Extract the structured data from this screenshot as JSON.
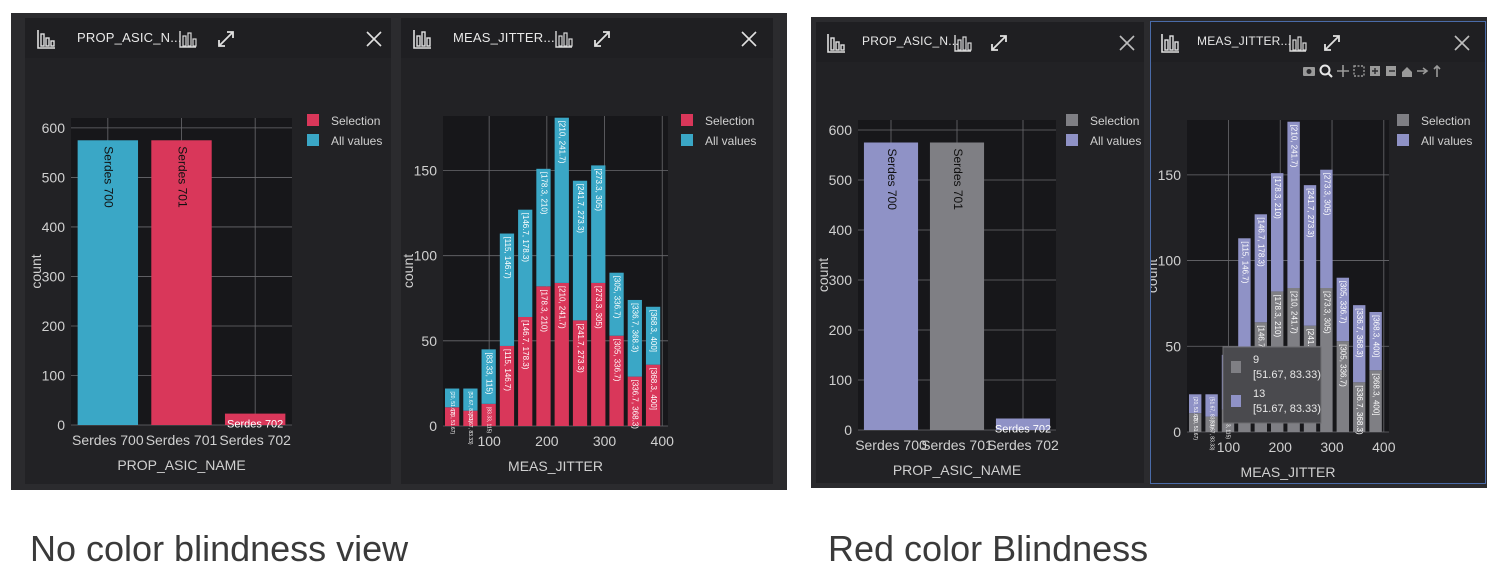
{
  "captions": {
    "left": "No color blindness view",
    "right": "Red color Blindness"
  },
  "views": [
    {
      "panels": [
        {
          "title": "PROP_ASIC_N...",
          "chart_data": {
            "type": "bar",
            "stacked": true,
            "xlabel": "PROP_ASIC_NAME",
            "ylabel": "count",
            "ylim": [
              0,
              620
            ],
            "yticks": [
              0,
              100,
              200,
              300,
              400,
              500,
              600
            ],
            "categories": [
              "Serdes 700",
              "Serdes 701",
              "Serdes 702"
            ],
            "series": [
              {
                "name": "Selection",
                "color": "#d9375a",
                "values": [
                  0,
                  575,
                  23
                ]
              },
              {
                "name": "All values",
                "color": "#3aa7c6",
                "values": [
                  575,
                  0,
                  0
                ]
              }
            ],
            "bar_labels": [
              "Serdes 700",
              "Serdes 701",
              "Serdes 702"
            ],
            "legend": "top-right"
          }
        },
        {
          "title": "MEAS_JITTER...",
          "chart_data": {
            "type": "bar",
            "stacked": true,
            "xlabel": "MEAS_JITTER",
            "ylabel": "count",
            "xlim": [
              20,
              410
            ],
            "xticks": [
              100,
              200,
              300,
              400
            ],
            "ylim": [
              0,
              182
            ],
            "yticks": [
              0,
              50,
              100,
              150
            ],
            "bins": [
              {
                "x0": 20,
                "x1": 51.67,
                "label": "[20, 51.67)"
              },
              {
                "x0": 51.67,
                "x1": 83.33,
                "label": "[51.67, 83.33)"
              },
              {
                "x0": 83.33,
                "x1": 115,
                "label": "[83.33, 115)"
              },
              {
                "x0": 115,
                "x1": 146.7,
                "label": "[115, 146.7)"
              },
              {
                "x0": 146.7,
                "x1": 178.3,
                "label": "[146.7, 178.3)"
              },
              {
                "x0": 178.3,
                "x1": 210,
                "label": "[178.3, 210)"
              },
              {
                "x0": 210,
                "x1": 241.7,
                "label": "[210, 241.7)"
              },
              {
                "x0": 241.7,
                "x1": 273.3,
                "label": "[241.7, 273.3)"
              },
              {
                "x0": 273.3,
                "x1": 305,
                "label": "[273.3, 305)"
              },
              {
                "x0": 305,
                "x1": 336.7,
                "label": "[305, 336.7)"
              },
              {
                "x0": 336.7,
                "x1": 368.3,
                "label": "[336.7, 368.3)"
              },
              {
                "x0": 368.3,
                "x1": 400,
                "label": "[368.3, 400]"
              }
            ],
            "series": [
              {
                "name": "Selection",
                "color": "#d9375a",
                "values": [
                  11,
                  9,
                  13,
                  47,
                  64,
                  82,
                  84,
                  62,
                  84,
                  53,
                  29,
                  36
                ]
              },
              {
                "name": "All values",
                "color": "#3aa7c6",
                "values": [
                  11,
                  13,
                  32,
                  66,
                  63,
                  69,
                  97,
                  82,
                  69,
                  37,
                  45,
                  34
                ]
              }
            ],
            "legend": "top-right"
          }
        }
      ]
    },
    {
      "panels": [
        {
          "title": "PROP_ASIC_N...",
          "chart_data": {
            "type": "bar",
            "stacked": true,
            "xlabel": "PROP_ASIC_NAME",
            "ylabel": "count",
            "ylim": [
              0,
              620
            ],
            "yticks": [
              0,
              100,
              200,
              300,
              400,
              500,
              600
            ],
            "categories": [
              "Serdes 700",
              "Serdes 701",
              "Serdes 702"
            ],
            "series": [
              {
                "name": "Selection",
                "color": "#7f7f84",
                "values": [
                  0,
                  575,
                  0
                ]
              },
              {
                "name": "All values",
                "color": "#8f92c6",
                "values": [
                  575,
                  0,
                  23
                ]
              }
            ],
            "bar_labels": [
              "Serdes 700",
              "Serdes 701",
              "Serdes 702"
            ],
            "legend": "top-right"
          }
        },
        {
          "title": "MEAS_JITTER...",
          "toolbar_icons": [
            "camera-icon",
            "zoom-icon",
            "pan-icon",
            "box-select-icon",
            "zoom-in-icon",
            "zoom-out-icon",
            "autoscale-icon",
            "reset-axes-icon",
            "spike-lines-icon"
          ],
          "chart_data": {
            "type": "bar",
            "stacked": true,
            "xlabel": "MEAS_JITTER",
            "ylabel": "count",
            "xlim": [
              20,
              410
            ],
            "xticks": [
              100,
              200,
              300,
              400
            ],
            "ylim": [
              0,
              182
            ],
            "yticks": [
              0,
              50,
              100,
              150
            ],
            "bins": [
              {
                "x0": 20,
                "x1": 51.67,
                "label": "[20, 51.67)"
              },
              {
                "x0": 51.67,
                "x1": 83.33,
                "label": "[51.67, 83.33)"
              },
              {
                "x0": 83.33,
                "x1": 115,
                "label": "[83.33, 115)"
              },
              {
                "x0": 115,
                "x1": 146.7,
                "label": "[115, 146.7)"
              },
              {
                "x0": 146.7,
                "x1": 178.3,
                "label": "[146.7, 178.3)"
              },
              {
                "x0": 178.3,
                "x1": 210,
                "label": "[178.3, 210)"
              },
              {
                "x0": 210,
                "x1": 241.7,
                "label": "[210, 241.7)"
              },
              {
                "x0": 241.7,
                "x1": 273.3,
                "label": "[241.7, 273.3)"
              },
              {
                "x0": 273.3,
                "x1": 305,
                "label": "[273.3, 305)"
              },
              {
                "x0": 305,
                "x1": 336.7,
                "label": "[305, 336.7)"
              },
              {
                "x0": 336.7,
                "x1": 368.3,
                "label": "[336.7, 368.3)"
              },
              {
                "x0": 368.3,
                "x1": 400,
                "label": "[368.3, 400]"
              }
            ],
            "series": [
              {
                "name": "Selection",
                "color": "#7f7f84",
                "values": [
                  11,
                  9,
                  13,
                  47,
                  64,
                  82,
                  84,
                  62,
                  84,
                  53,
                  29,
                  36
                ]
              },
              {
                "name": "All values",
                "color": "#8f92c6",
                "values": [
                  11,
                  13,
                  32,
                  66,
                  63,
                  69,
                  97,
                  82,
                  69,
                  37,
                  45,
                  34
                ]
              }
            ],
            "legend": "top-right",
            "tooltip": {
              "items": [
                {
                  "color": "#7f7f84",
                  "count": "9",
                  "range": "[51.67, 83.33)"
                },
                {
                  "color": "#8f92c6",
                  "count": "13",
                  "range": "[51.67, 83.33)"
                }
              ]
            }
          }
        }
      ]
    }
  ]
}
